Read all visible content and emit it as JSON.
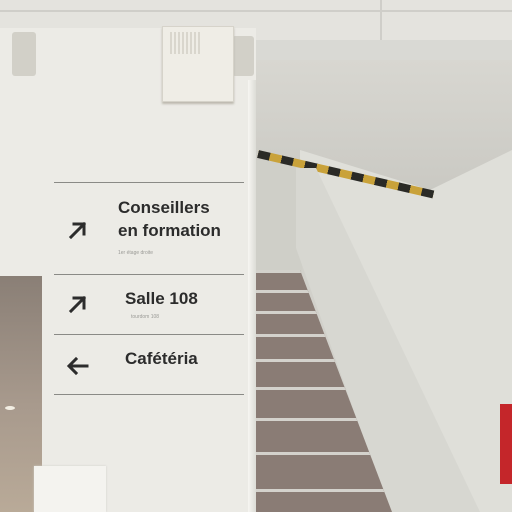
{
  "signage": {
    "entries": [
      {
        "title_line1": "Conseillers",
        "title_line2": "en formation",
        "subtitle": "1er étage droite",
        "arrow_icon": "arrow-up-right-icon"
      },
      {
        "title_line1": "Salle 108",
        "subtitle": "tourdom 108",
        "arrow_icon": "arrow-up-right-icon"
      },
      {
        "title_line1": "Cafétéria",
        "arrow_icon": "arrow-left-icon"
      }
    ]
  },
  "colors": {
    "wall": "#ecebe6",
    "text": "#2c2c2c",
    "stairs": "#8a7c75",
    "hazard_yellow": "#c9a23a",
    "exit_sign_red": "#c4262a"
  }
}
